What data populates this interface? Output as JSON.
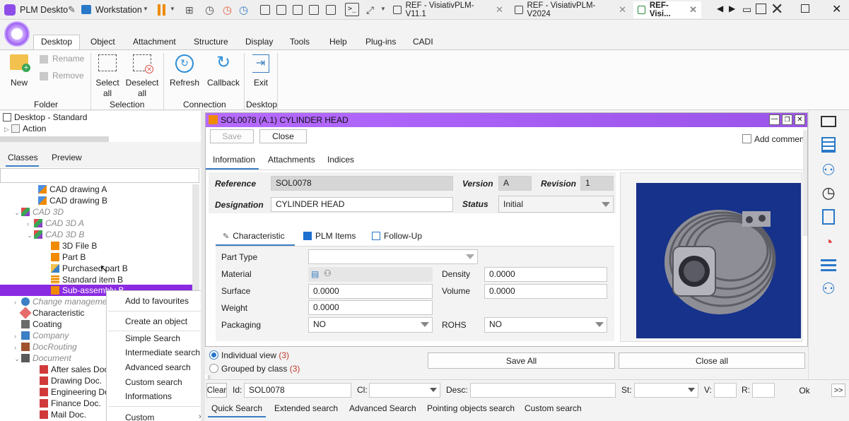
{
  "titlebar": {
    "app_title": "PLM Deskto",
    "workstation_label": "Workstation",
    "tabs": [
      {
        "label": "REF - VisiativPLM-V11.1"
      },
      {
        "label": "REF - VisiativPLM-V2024"
      },
      {
        "label": "REF-Visi..."
      }
    ]
  },
  "ribbon": {
    "tabs": [
      "Desktop",
      "Object",
      "Attachment",
      "Structure",
      "Display",
      "Tools",
      "Help",
      "Plug-ins",
      "CADI"
    ],
    "new_label": "New",
    "rename_label": "Rename",
    "remove_label": "Remove",
    "select_all_label_1": "Select",
    "select_all_label_2": "all",
    "deselect_all_label_1": "Deselect",
    "deselect_all_label_2": "all",
    "refresh_label": "Refresh",
    "callback_label": "Callback",
    "exit_label": "Exit",
    "groups": {
      "folder": "Folder",
      "selection": "Selection",
      "connection": "Connection",
      "desktop": "Desktop"
    }
  },
  "left": {
    "desktop_label": "Desktop - Standard",
    "action_label": "Action",
    "tabs": {
      "classes": "Classes",
      "preview": "Preview"
    },
    "tree": {
      "cad_drawing_a": "CAD drawing A",
      "cad_drawing_b": "CAD drawing B",
      "cad_3d": "CAD 3D",
      "cad_3d_a": "CAD 3D A",
      "cad_3d_b": "CAD 3D B",
      "file_3d_b": "3D File B",
      "part_b": "Part B",
      "purchased_part_b": "Purchased part B",
      "standard_item_b": "Standard item B",
      "sub_assembly_b": "Sub-assembly B",
      "change_management": "Change manageme",
      "characteristic": "Characteristic",
      "coating": "Coating",
      "company": "Company",
      "docrouting": "DocRouting",
      "document": "Document",
      "after_sales_doc": "After sales Doc",
      "drawing_doc": "Drawing Doc.",
      "engineering_doc": "Engineering Do",
      "finance_doc": "Finance Doc.",
      "mail_doc": "Mail Doc."
    }
  },
  "context_menu": {
    "add_to_favourites": "Add to favourites",
    "create_an_object": "Create an object",
    "simple_search": "Simple Search",
    "intermediate_search": "Intermediate search",
    "advanced_search": "Advanced search",
    "custom_search": "Custom search",
    "informations": "Informations",
    "custom": "Custom"
  },
  "dialog": {
    "title": "SOL0078 (A.1) CYLINDER HEAD",
    "save_label": "Save",
    "close_label": "Close",
    "add_comment_label": "Add comment",
    "tabs": [
      "Information",
      "Attachments",
      "Indices"
    ],
    "reference_label": "Reference",
    "reference_value": "SOL0078",
    "version_label": "Version",
    "version_value": "A",
    "revision_label": "Revision",
    "revision_value": "1",
    "designation_label": "Designation",
    "designation_value": "CYLINDER HEAD",
    "status_label": "Status",
    "status_value": "Initial",
    "subtabs": [
      "Characteristic",
      "PLM Items",
      "Follow-Up"
    ],
    "part_type_label": "Part Type",
    "part_type_value": "",
    "material_label": "Material",
    "density_label": "Density",
    "density_value": "0.0000",
    "surface_label": "Surface",
    "surface_value": "0.0000",
    "volume_label": "Volume",
    "volume_value": "0.0000",
    "weight_label": "Weight",
    "weight_value": "0.0000",
    "packaging_label": "Packaging",
    "packaging_value": "NO",
    "rohs_label": "ROHS",
    "rohs_value": "NO"
  },
  "bottom": {
    "individual_view_label": "Individual view",
    "individual_view_count": "(3)",
    "grouped_by_class_label": "Grouped by class",
    "grouped_by_class_count": "(3)",
    "save_all_label": "Save All",
    "close_all_label": "Close all",
    "clear_label": "Clear",
    "id_label": "Id:",
    "id_value": "SOL0078",
    "cl_label": "Cl:",
    "desc_label": "Desc:",
    "st_label": "St:",
    "v_label": "V:",
    "r_label": "R:",
    "ok_label": "Ok",
    "more_label": ">>",
    "search_tabs": [
      "Quick Search",
      "Extended search",
      "Advanced Search",
      "Pointing objects search",
      "Custom search"
    ]
  },
  "colors": {
    "accent_purple": "#9b4dea",
    "selection_purple": "#8a2be2"
  }
}
